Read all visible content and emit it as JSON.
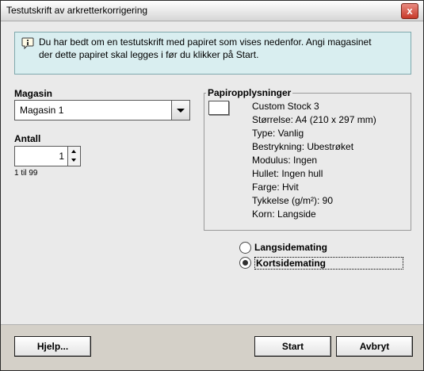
{
  "window": {
    "title": "Testutskrift av arkretterkorrigering",
    "close_label": "x"
  },
  "info": {
    "icon": "info-speech-icon",
    "line1": "Du har bedt om en testutskrift med papiret som vises nedenfor.  Angi magasinet",
    "line2": "der dette papiret skal legges i før du klikker på Start."
  },
  "magasin": {
    "label": "Magasin",
    "selected": "Magasin 1"
  },
  "antall": {
    "label": "Antall",
    "value": "1",
    "range": "1 til 99"
  },
  "paper": {
    "title": "Papiropplysninger",
    "lines": [
      "Custom Stock 3",
      "Størrelse: A4 (210 x 297 mm)",
      "Type: Vanlig",
      "Bestrykning: Ubestrøket",
      "Modulus: Ingen",
      "Hullet: Ingen hull",
      "Farge: Hvit",
      "Tykkelse (g/m²): 90",
      "Korn: Langside"
    ]
  },
  "feed": {
    "options": [
      {
        "label": "Langsidemating",
        "selected": false
      },
      {
        "label": "Kortsidemating",
        "selected": true
      }
    ]
  },
  "buttons": {
    "help": "Hjelp...",
    "start": "Start",
    "cancel": "Avbryt"
  }
}
